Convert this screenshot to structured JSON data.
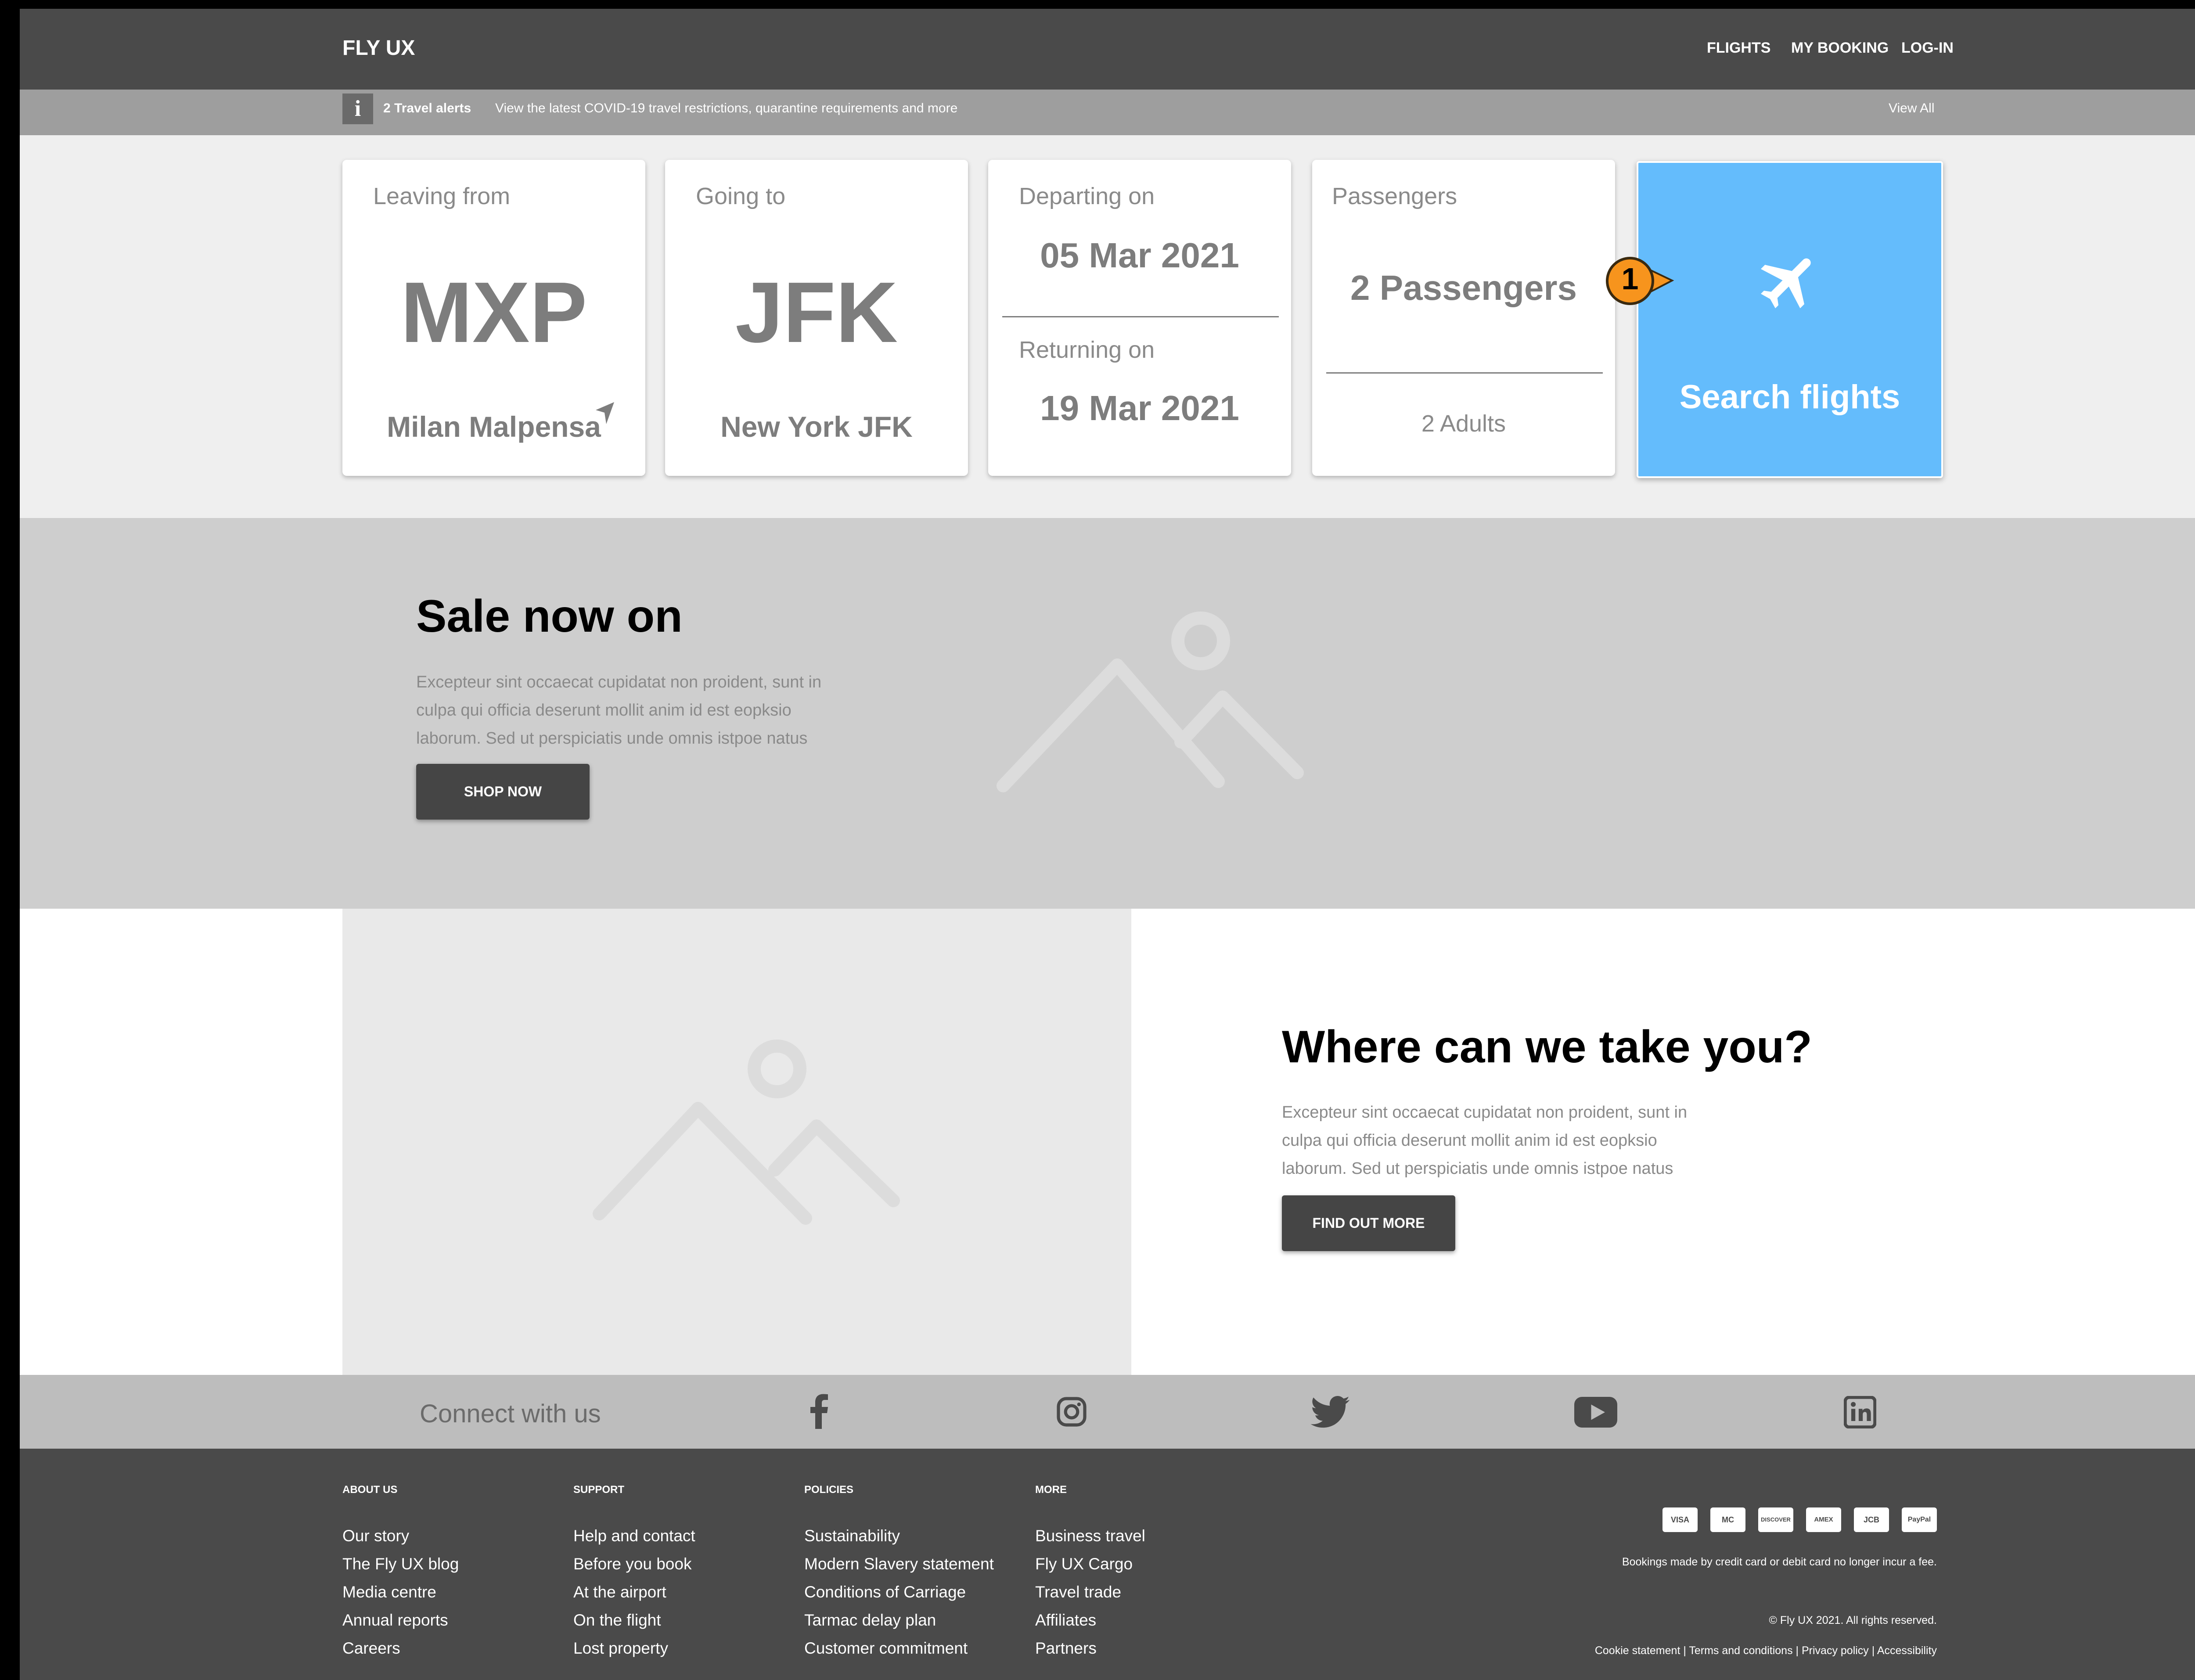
{
  "header": {
    "brand": "FLY UX",
    "nav": {
      "flights": "FLIGHTS",
      "my_booking": "MY BOOKING",
      "login": "LOG-IN"
    }
  },
  "alert": {
    "icon": "info-icon",
    "info_glyph": "i",
    "count_text": "2 Travel alerts",
    "message": "View the latest COVID-19 travel restrictions, quarantine requirements and more",
    "view_all": "View All"
  },
  "search": {
    "leaving": {
      "caption": "Leaving from",
      "code": "MXP",
      "city": "Milan Malpensa",
      "icon": "location-arrow-icon"
    },
    "going": {
      "caption": "Going to",
      "code": "JFK",
      "city": "New York JFK"
    },
    "dates": {
      "depart_caption": "Departing on",
      "depart_date": "05 Mar 2021",
      "return_caption": "Returning on",
      "return_date": "19 Mar 2021"
    },
    "passengers": {
      "caption": "Passengers",
      "value": "2 Passengers",
      "detail": "2 Adults"
    },
    "button": {
      "label": "Search flights",
      "icon": "airplane-icon"
    },
    "annotation": {
      "number": "1",
      "color": "#f7941d"
    },
    "accent_color": "#64bcfc"
  },
  "sale": {
    "title": "Sale now on",
    "body": "Excepteur sint occaecat cupidatat non proident, sunt in culpa qui officia deserunt mollit anim id est eopksio laborum. Sed ut perspiciatis unde omnis istpoe natus",
    "button": "SHOP NOW",
    "image_icon": "image-placeholder-icon"
  },
  "where": {
    "title": "Where can we take you?",
    "body": "Excepteur sint occaecat cupidatat non proident, sunt in culpa qui officia deserunt mollit anim id est eopksio laborum. Sed ut perspiciatis unde omnis istpoe natus",
    "button": "FIND OUT MORE",
    "image_icon": "image-placeholder-icon"
  },
  "connect": {
    "label": "Connect with us",
    "icons": [
      "facebook-icon",
      "instagram-icon",
      "twitter-icon",
      "youtube-icon",
      "linkedin-icon"
    ]
  },
  "footer": {
    "columns": [
      {
        "heading": "ABOUT US",
        "links": [
          "Our story",
          "The Fly UX blog",
          "Media centre",
          "Annual reports",
          "Careers"
        ]
      },
      {
        "heading": "SUPPORT",
        "links": [
          "Help and contact",
          "Before you book",
          "At the airport",
          "On the flight",
          "Lost property"
        ]
      },
      {
        "heading": "POLICIES",
        "links": [
          "Sustainability",
          "Modern Slavery statement",
          "Conditions of Carriage",
          "Tarmac delay plan",
          "Customer commitment"
        ]
      },
      {
        "heading": "MORE",
        "links": [
          "Business travel",
          "Fly UX Cargo",
          "Travel trade",
          "Affiliates",
          "Partners"
        ]
      }
    ],
    "payment_cards": [
      "VISA",
      "MC",
      "DISCOVER",
      "AMEX",
      "JCB",
      "PayPal"
    ],
    "payment_note": "Bookings made by credit card or debit card no longer incur a fee.",
    "copyright": "© Fly UX 2021. All rights reserved.",
    "legal_links": [
      "Cookie statement",
      "Terms and conditions",
      "Privacy policy",
      "Accessibility"
    ],
    "legal_separator": "|"
  }
}
